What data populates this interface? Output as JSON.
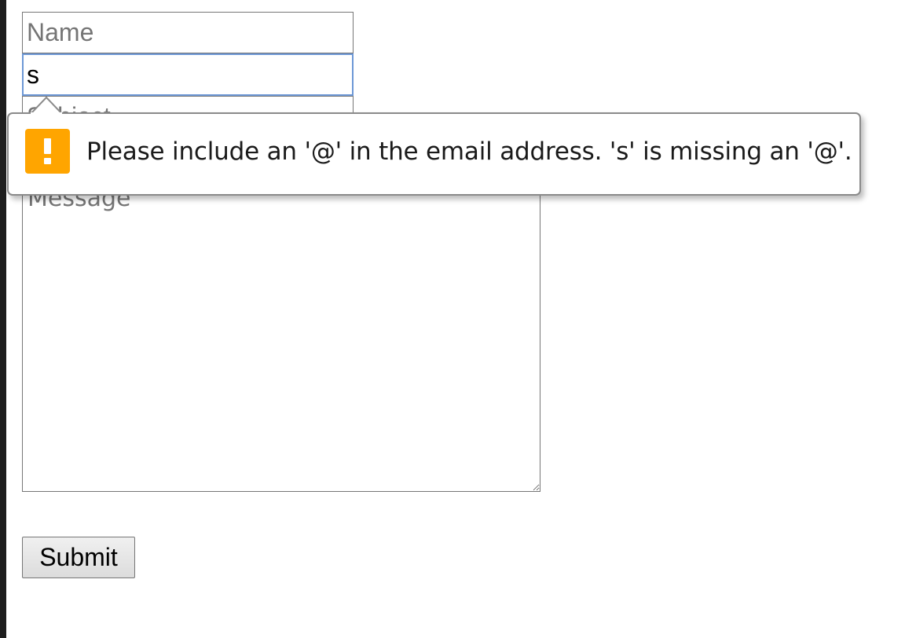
{
  "form": {
    "name_placeholder": "Name",
    "email_value": "s",
    "subject_placeholder": "Subject",
    "message_placeholder": "Message",
    "submit_label": "Submit"
  },
  "validation": {
    "message": "Please include an '@' in the email address. 's' is missing an '@'.",
    "icon": "warning-icon",
    "icon_color": "#ffa500"
  },
  "colors": {
    "focus_border": "#6d98d6",
    "placeholder": "#757575"
  }
}
